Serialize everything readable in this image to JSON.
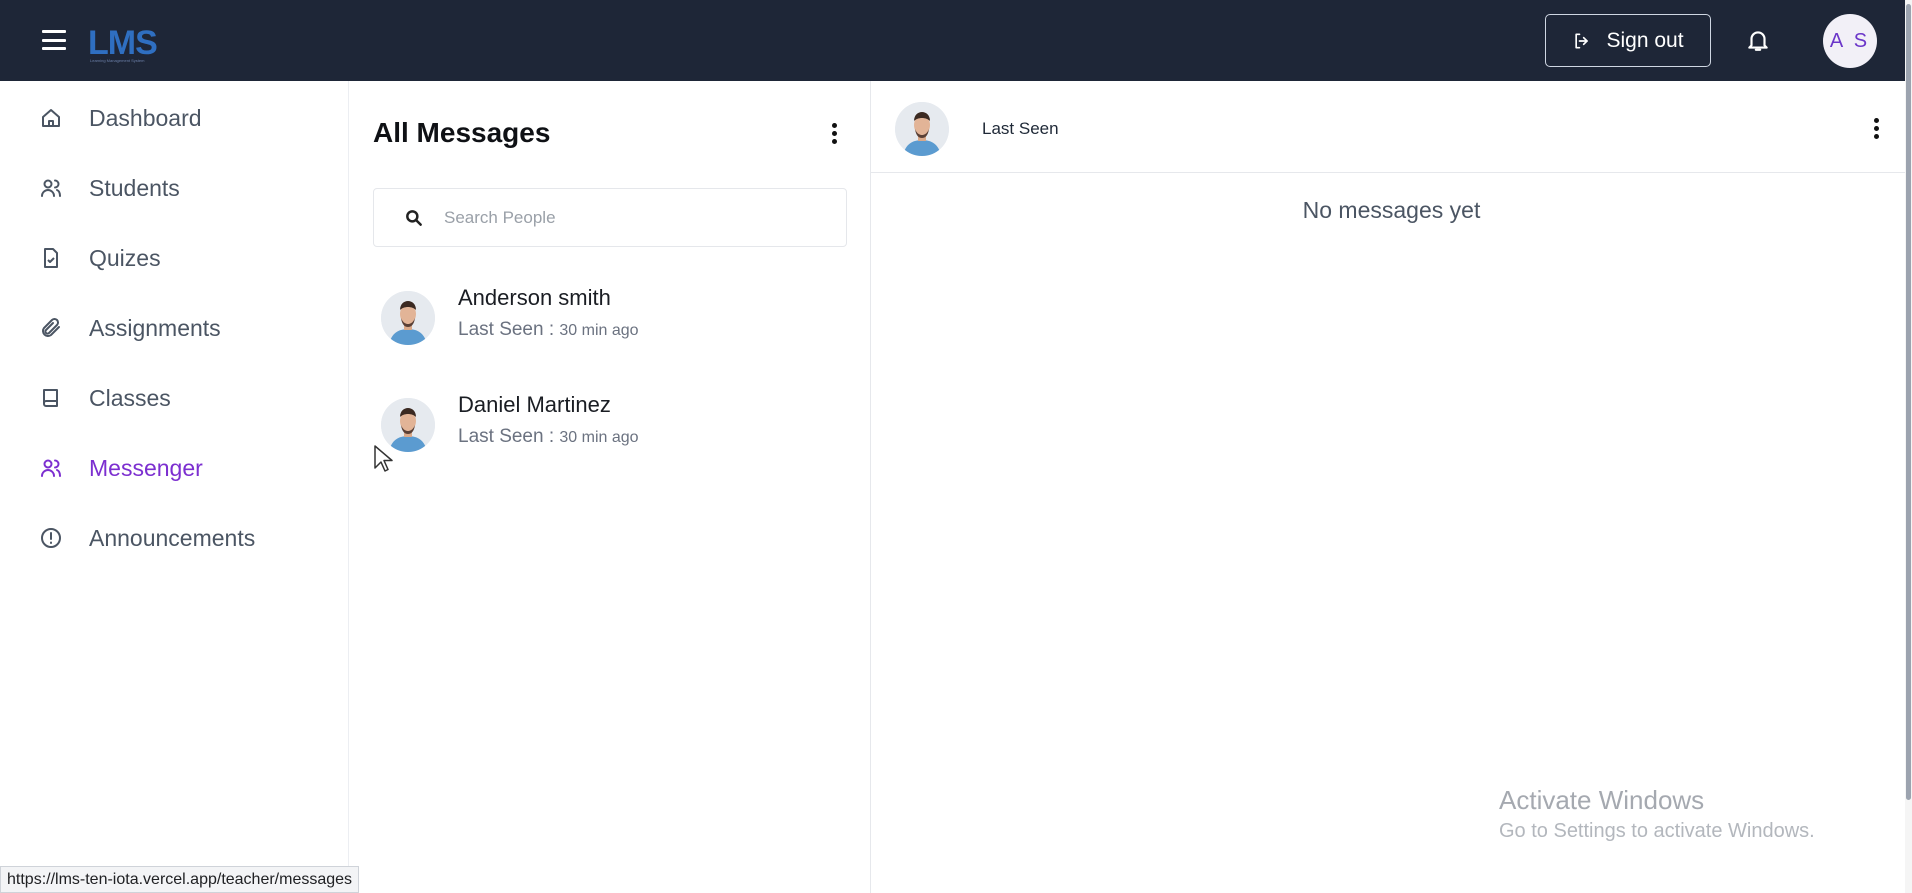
{
  "header": {
    "logo_text": "LMS",
    "logo_subtitle": "Learning Management System",
    "signout_label": "Sign out",
    "user_initials": "A S"
  },
  "sidebar": {
    "items": [
      {
        "label": "Dashboard",
        "icon": "home-icon"
      },
      {
        "label": "Students",
        "icon": "users-icon"
      },
      {
        "label": "Quizes",
        "icon": "document-icon"
      },
      {
        "label": "Assignments",
        "icon": "paperclip-icon"
      },
      {
        "label": "Classes",
        "icon": "book-icon"
      },
      {
        "label": "Messenger",
        "icon": "users-icon",
        "active": true
      },
      {
        "label": "Announcements",
        "icon": "alert-circle-icon"
      }
    ],
    "active_color": "#7c2fd0"
  },
  "messages": {
    "title": "All Messages",
    "search_placeholder": "Search People",
    "contacts": [
      {
        "name": "Anderson smith",
        "seen_label": "Last Seen : ",
        "seen_time": "30 min ago"
      },
      {
        "name": "Daniel Martinez",
        "seen_label": "Last Seen : ",
        "seen_time": "30 min ago"
      }
    ]
  },
  "chat": {
    "status": "Last Seen",
    "empty_text": "No messages yet"
  },
  "overlay": {
    "watermark_title": "Activate Windows",
    "watermark_subtitle": "Go to Settings to activate Windows.",
    "status_url": "https://lms-ten-iota.vercel.app/teacher/messages"
  },
  "colors": {
    "topbar": "#1e2637",
    "accent": "#7c2fd0"
  }
}
